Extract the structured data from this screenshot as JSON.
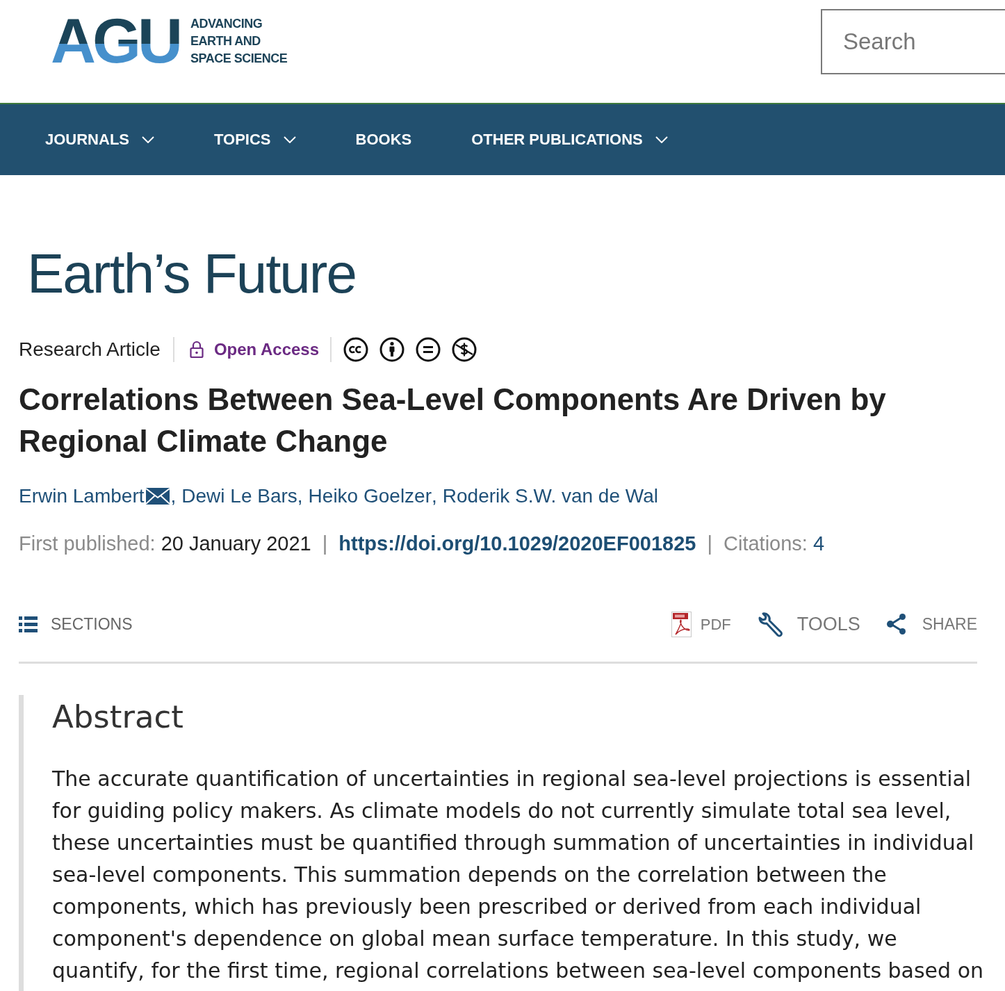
{
  "header": {
    "logo": {
      "mark": "AGU",
      "tagline": [
        "ADVANCING",
        "EARTH AND",
        "SPACE SCIENCE"
      ]
    },
    "search": {
      "placeholder": "Search"
    }
  },
  "nav": {
    "items": [
      {
        "label": "JOURNALS",
        "dropdown": true
      },
      {
        "label": "TOPICS",
        "dropdown": true
      },
      {
        "label": "BOOKS",
        "dropdown": false
      },
      {
        "label": "OTHER PUBLICATIONS",
        "dropdown": true
      }
    ]
  },
  "journal": {
    "title": "Earth’s Future"
  },
  "article": {
    "type": "Research Article",
    "access": {
      "label": "Open Access"
    },
    "title": "Correlations Between Sea-Level Components Are Driven by Regional Climate Change",
    "authors": [
      {
        "name": "Erwin Lambert",
        "corresponding": true,
        "separator": ","
      },
      {
        "name": "Dewi Le Bars",
        "corresponding": false,
        "separator": ","
      },
      {
        "name": "Heiko Goelzer",
        "corresponding": false,
        "separator": ","
      },
      {
        "name": "Roderik S.W. van de Wal",
        "corresponding": false
      }
    ],
    "publication": [
      {
        "kind": "date",
        "label": "First published:",
        "value": "20 January 2021",
        "separator": "|"
      },
      {
        "kind": "doi",
        "value": "https://doi.org/10.1029/2020EF001825",
        "separator": "|"
      },
      {
        "kind": "citations",
        "label": "Citations:",
        "value": "4"
      }
    ]
  },
  "toolbar": {
    "left": [
      {
        "kind": "list",
        "label": "SECTIONS"
      }
    ],
    "right": [
      {
        "kind": "pdf",
        "label": "PDF"
      },
      {
        "kind": "wrench",
        "label": "TOOLS"
      },
      {
        "kind": "share",
        "label": "SHARE"
      }
    ]
  },
  "abstract": {
    "heading": "Abstract",
    "text": "The accurate quantification of uncertainties in regional sea-level projections is essential for guiding policy makers. As climate models do not currently simulate total sea level, these uncertainties must be quantified through summation of uncertainties in individual sea-level components. This summation depends on the correlation between the components, which has previously been prescribed or derived from each individual component's dependence on global mean surface temperature. In this study, we quantify, for the first time, regional correlations between sea-level components based on"
  }
}
